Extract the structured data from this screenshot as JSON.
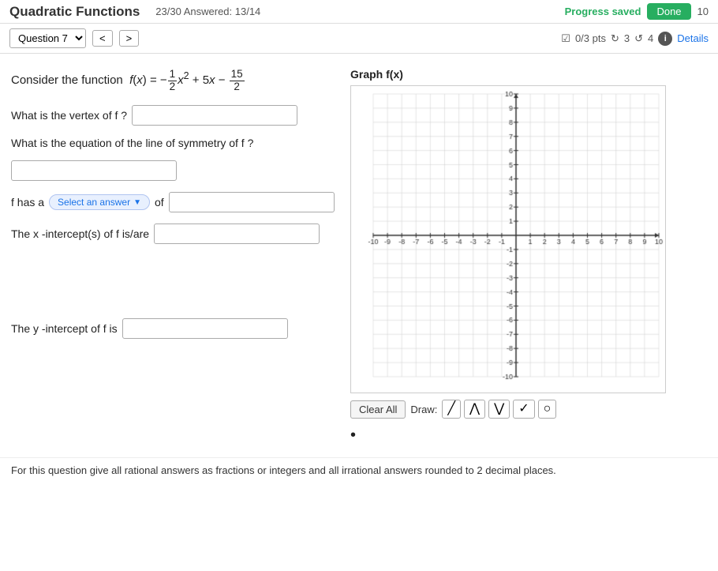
{
  "header": {
    "title": "Quadratic Functions",
    "progress_saved": "Progress saved",
    "done_label": "Done",
    "attempts": "10",
    "answered": "23/30  Answered: 13/14"
  },
  "question_nav": {
    "question_label": "Question 7",
    "nav_prev": "<",
    "nav_next": ">",
    "pts": "0/3 pts",
    "retries": "3",
    "resubmits": "4",
    "details_label": "Details"
  },
  "question": {
    "intro": "Consider the function",
    "graph_title": "Graph f(x)",
    "vertex_label": "What is the vertex of f ?",
    "symmetry_label": "What is the equation of the line of symmetry of f ?",
    "has_a_prefix": "f has a",
    "select_answer_label": "Select an answer",
    "has_a_suffix": "of",
    "x_intercept_label": "The x -intercept(s) of f  is/are",
    "y_intercept_label": "The y -intercept of f  is",
    "vertex_value": "",
    "symmetry_value": "",
    "has_a_value": "",
    "x_intercept_value": "",
    "y_intercept_value": ""
  },
  "toolbar": {
    "clear_all_label": "Clear All",
    "draw_label": "Draw:",
    "tools": [
      "line",
      "arch",
      "v-shape",
      "checkmark",
      "circle"
    ]
  },
  "footer": {
    "note": "For this question give all rational answers as fractions or integers and all irrational answers rounded to 2 decimal places."
  },
  "graph": {
    "x_min": -10,
    "x_max": 10,
    "y_min": -10,
    "y_max": 10,
    "x_labels": [
      "-10",
      "-9",
      "-8",
      "-7",
      "-6",
      "-5",
      "-4",
      "-3",
      "-2",
      "-1",
      "1",
      "2",
      "3",
      "4",
      "5",
      "6",
      "7",
      "8",
      "9",
      "10"
    ],
    "y_labels": [
      "-10",
      "-9",
      "-8",
      "-7",
      "-6",
      "-5",
      "-4",
      "-3",
      "-2",
      "-1",
      "1",
      "2",
      "3",
      "4",
      "5",
      "6",
      "7",
      "8",
      "9",
      "10"
    ]
  }
}
